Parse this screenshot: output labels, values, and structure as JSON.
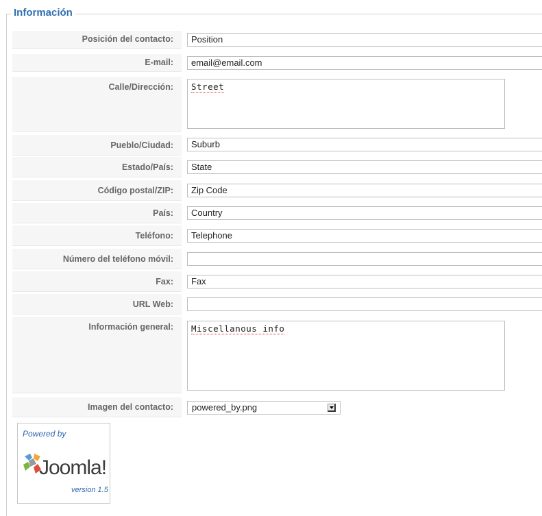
{
  "legend": "Información",
  "fields": {
    "position": {
      "label": "Posición del contacto:",
      "value": "Position"
    },
    "email": {
      "label": "E-mail:",
      "value": "email@email.com"
    },
    "street": {
      "label": "Calle/Dirección:",
      "value": "Street"
    },
    "suburb": {
      "label": "Pueblo/Ciudad:",
      "value": "Suburb"
    },
    "state": {
      "label": "Estado/País:",
      "value": "State"
    },
    "postcode": {
      "label": "Código postal/ZIP:",
      "value": "Zip Code"
    },
    "country": {
      "label": "País:",
      "value": "Country"
    },
    "telephone": {
      "label": "Teléfono:",
      "value": "Telephone"
    },
    "mobile": {
      "label": "Número del teléfono móvil:",
      "value": ""
    },
    "fax": {
      "label": "Fax:",
      "value": "Fax"
    },
    "webpage": {
      "label": "URL Web:",
      "value": ""
    },
    "misc": {
      "label": "Información general:",
      "value": "Miscellanous info"
    },
    "image": {
      "label": "Imagen del contacto:",
      "value": "powered_by.png"
    }
  },
  "logo": {
    "powered": "Powered by",
    "brand": "Joomla!",
    "version": "version 1.5"
  }
}
